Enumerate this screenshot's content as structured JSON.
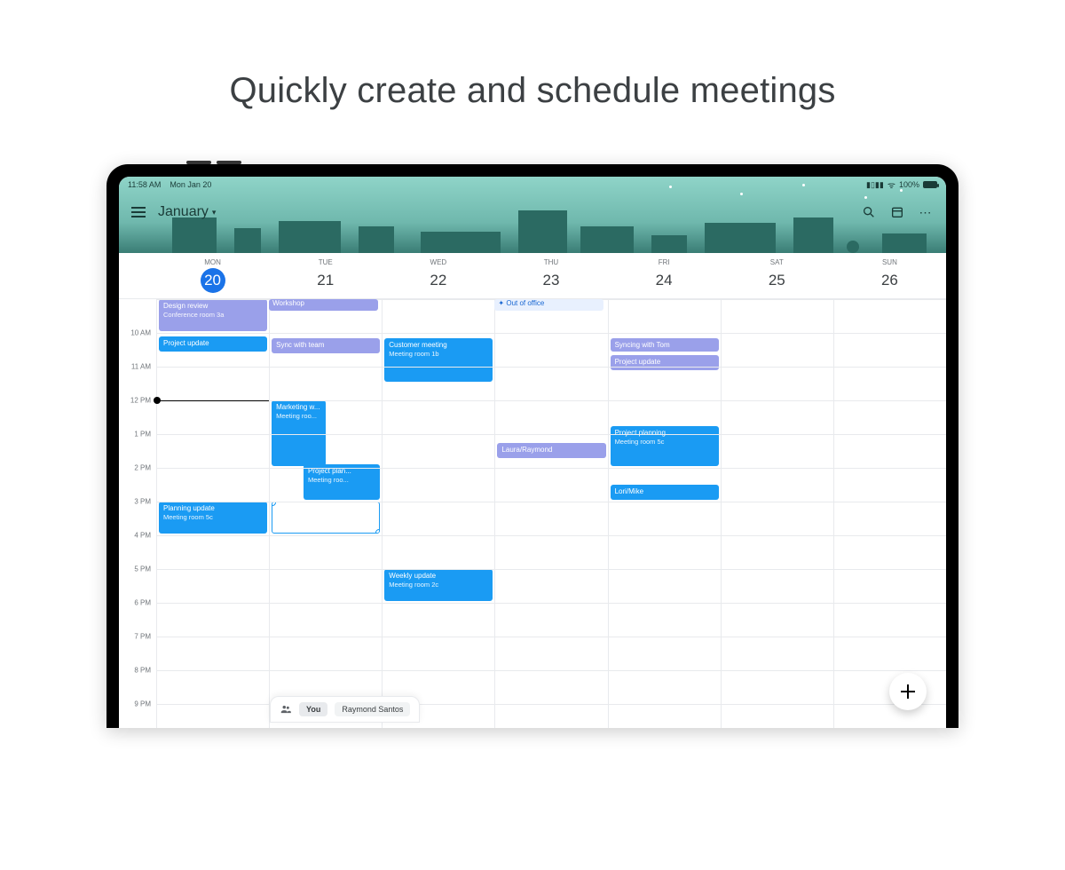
{
  "headline": "Quickly create and schedule meetings",
  "statusbar": {
    "time": "11:58 AM",
    "date": "Mon Jan 20",
    "wifi": "100%"
  },
  "appbar": {
    "month": "January"
  },
  "days": [
    {
      "dow": "MON",
      "num": "20",
      "today": true
    },
    {
      "dow": "TUE",
      "num": "21",
      "today": false
    },
    {
      "dow": "WED",
      "num": "22",
      "today": false
    },
    {
      "dow": "THU",
      "num": "23",
      "today": false
    },
    {
      "dow": "FRI",
      "num": "24",
      "today": false
    },
    {
      "dow": "SAT",
      "num": "25",
      "today": false
    },
    {
      "dow": "SUN",
      "num": "26",
      "today": false
    }
  ],
  "hours": [
    "10 AM",
    "11 AM",
    "12 PM",
    "1 PM",
    "2 PM",
    "3 PM",
    "4 PM",
    "5 PM",
    "6 PM",
    "7 PM",
    "8 PM",
    "9 PM"
  ],
  "hourHeight": 38,
  "firstHour": 9,
  "nowHour": 12,
  "allday": [
    {
      "title": "Workshop",
      "col": 1,
      "span": 1,
      "color": "purple"
    },
    {
      "title": "✦ Out of office",
      "col": 3,
      "span": 1,
      "color": "pale"
    }
  ],
  "events": {
    "mon": [
      {
        "title": "Design review",
        "sub": "Conference room 3a",
        "start": 9.0,
        "end": 10.0,
        "color": "purple"
      },
      {
        "title": "Project update",
        "sub": "",
        "start": 10.1,
        "end": 10.6,
        "color": "blue"
      },
      {
        "title": "Planning update",
        "sub": "Meeting room 5c",
        "start": 15.0,
        "end": 16.0,
        "color": "blue"
      }
    ],
    "tue": [
      {
        "title": "Sync with team",
        "sub": "",
        "start": 10.15,
        "end": 10.65,
        "color": "purple"
      },
      {
        "title": "Marketing w...",
        "sub": "Meeting roo...",
        "start": 12.0,
        "end": 14.0,
        "color": "blue",
        "narrow": true
      },
      {
        "title": "Project plan...",
        "sub": "Meeting roo...",
        "start": 13.9,
        "end": 15.0,
        "color": "blue",
        "rightHalf": true
      },
      {
        "title": "",
        "sub": "",
        "start": 15.0,
        "end": 16.0,
        "color": "outline",
        "handles": true
      }
    ],
    "wed": [
      {
        "title": "Customer meeting",
        "sub": "Meeting room 1b",
        "start": 10.15,
        "end": 11.5,
        "color": "blue"
      },
      {
        "title": "Weekly update",
        "sub": "Meeting room 2c",
        "start": 17.0,
        "end": 18.0,
        "color": "blue"
      }
    ],
    "thu": [
      {
        "title": "Laura/Raymond",
        "sub": "",
        "start": 13.25,
        "end": 13.75,
        "color": "purple"
      }
    ],
    "fri": [
      {
        "title": "Syncing with Tom",
        "sub": "",
        "start": 10.15,
        "end": 10.6,
        "color": "purple"
      },
      {
        "title": "Project update",
        "sub": "",
        "start": 10.65,
        "end": 11.15,
        "color": "purple"
      },
      {
        "title": "Project planning",
        "sub": "Meeting room 5c",
        "start": 12.75,
        "end": 14.0,
        "color": "blue"
      },
      {
        "title": "Lori/Mike",
        "sub": "",
        "start": 14.5,
        "end": 15.0,
        "color": "blue"
      }
    ],
    "sat": [],
    "sun": []
  },
  "attendees": {
    "you": "You",
    "other": "Raymond Santos"
  }
}
